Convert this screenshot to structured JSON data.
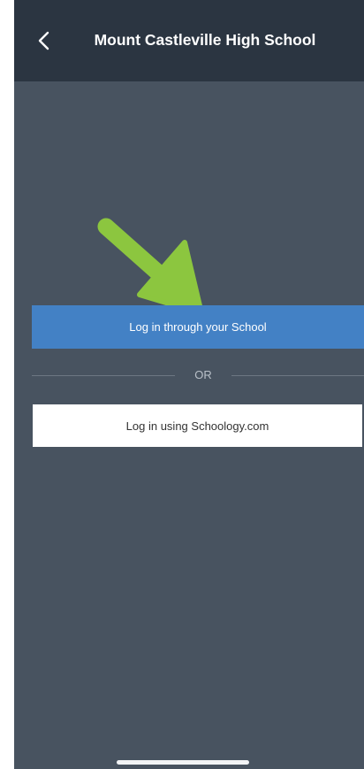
{
  "header": {
    "title": "Mount Castleville High School",
    "back_icon": "chevron-left-icon"
  },
  "login": {
    "school_button_label": "Log in through your School",
    "divider_label": "OR",
    "schoology_button_label": "Log in using Schoology.com"
  },
  "annotation": {
    "arrow_icon": "arrow-down-right-icon",
    "arrow_color": "#8cc63f"
  },
  "colors": {
    "nav_background": "#2b3541",
    "page_background": "#485360",
    "primary_button": "#4381c5",
    "secondary_button": "#ffffff"
  }
}
